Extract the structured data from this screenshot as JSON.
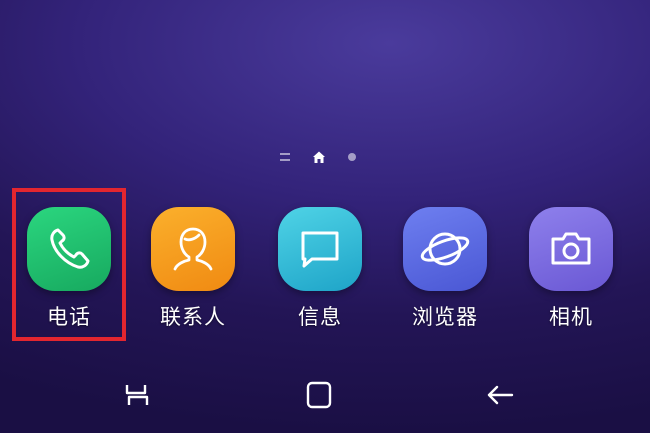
{
  "home_screen": {
    "page_indicator": {
      "items": [
        "apps-page",
        "home-page",
        "page-2"
      ],
      "active": "home-page"
    },
    "dock": {
      "apps": [
        {
          "label": "电话",
          "icon": "phone-icon",
          "color": "#1fbf6f",
          "highlighted": true
        },
        {
          "label": "联系人",
          "icon": "contacts-icon",
          "color": "#f79a1e"
        },
        {
          "label": "信息",
          "icon": "messages-icon",
          "color": "#2ec4d6"
        },
        {
          "label": "浏览器",
          "icon": "browser-icon",
          "color": "#5a6de3"
        },
        {
          "label": "相机",
          "icon": "camera-icon",
          "color": "#7d6ce0"
        }
      ]
    },
    "highlight_color": "#e3262f"
  },
  "navigation_bar": {
    "buttons": [
      {
        "name": "recent-apps-button",
        "icon": "recent-apps-icon"
      },
      {
        "name": "home-button",
        "icon": "home-square-icon"
      },
      {
        "name": "back-button",
        "icon": "back-arrow-icon"
      }
    ]
  }
}
